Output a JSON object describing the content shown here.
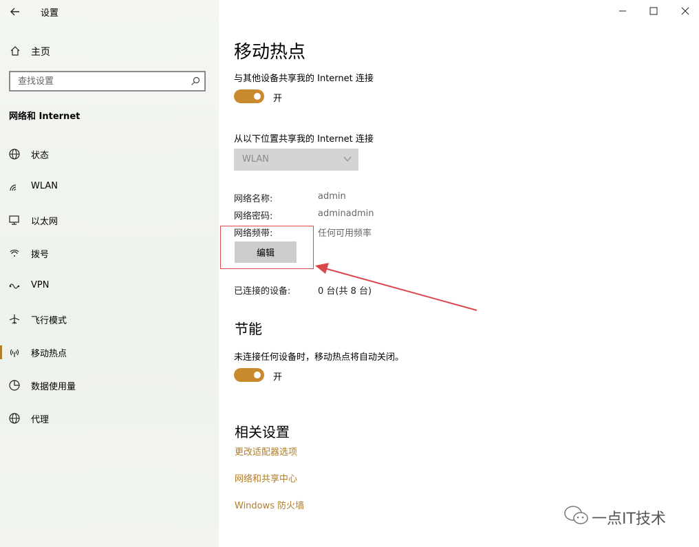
{
  "app": {
    "title": "设置"
  },
  "sidebar": {
    "home_label": "主页",
    "search_placeholder": "查找设置",
    "section_title": "网络和 Internet",
    "items": [
      {
        "label": "状态",
        "icon": "globe-icon"
      },
      {
        "label": "WLAN",
        "icon": "wifi-icon"
      },
      {
        "label": "以太网",
        "icon": "ethernet-icon"
      },
      {
        "label": "拨号",
        "icon": "dialup-icon"
      },
      {
        "label": "VPN",
        "icon": "vpn-icon"
      },
      {
        "label": "飞行模式",
        "icon": "airplane-icon"
      },
      {
        "label": "移动热点",
        "icon": "hotspot-icon",
        "active": true
      },
      {
        "label": "数据使用量",
        "icon": "data-usage-icon"
      },
      {
        "label": "代理",
        "icon": "globe-icon"
      }
    ]
  },
  "main": {
    "title": "移动热点",
    "share_label": "与其他设备共享我的 Internet 连接",
    "share_toggle": "开",
    "share_from_label": "从以下位置共享我的 Internet 连接",
    "share_from_value": "WLAN",
    "network_name_key": "网络名称:",
    "network_name_value": "admin",
    "network_password_key": "网络密码:",
    "network_password_value": "adminadmin",
    "network_band_key": "网络频带:",
    "network_band_value": "任何可用频率",
    "edit_button": "编辑",
    "connected_key": "已连接的设备:",
    "connected_value": "0 台(共 8 台)",
    "power_title": "节能",
    "power_label": "未连接任何设备时，移动热点将自动关闭。",
    "power_toggle": "开",
    "related_title": "相关设置",
    "links": [
      "更改适配器选项",
      "网络和共享中心",
      "Windows 防火墙"
    ]
  },
  "watermark": {
    "text": "一点IT技术"
  },
  "colors": {
    "accent": "#c98a2e",
    "link": "#b07d2a",
    "annotation": "#d9464b"
  }
}
